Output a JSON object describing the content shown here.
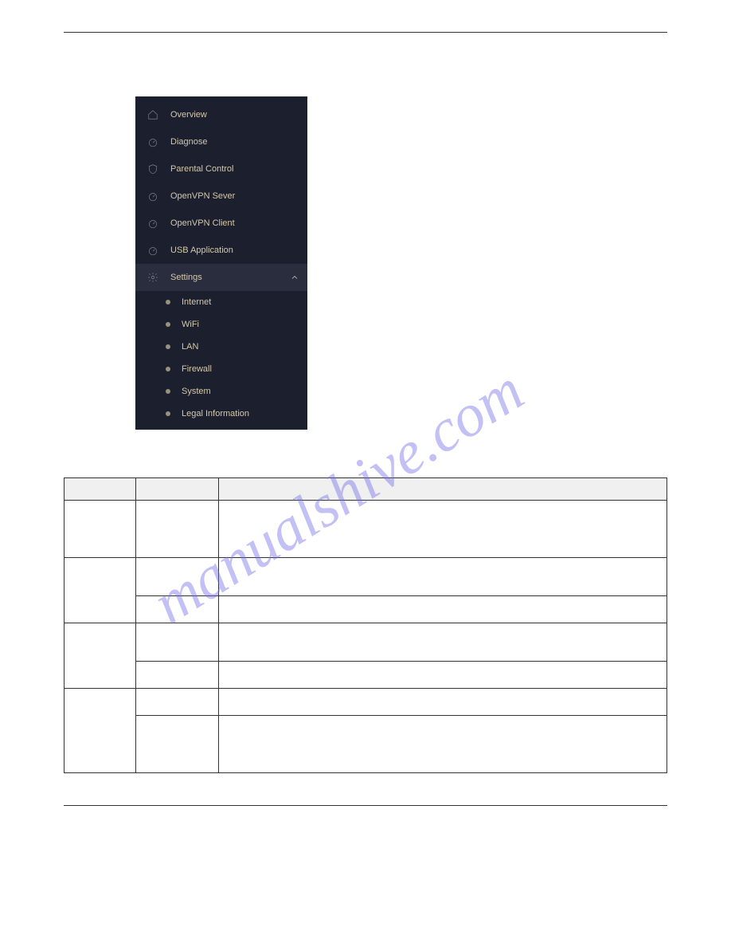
{
  "sidebar": {
    "items": [
      {
        "label": "Overview",
        "icon": "home-icon"
      },
      {
        "label": "Diagnose",
        "icon": "gauge-icon"
      },
      {
        "label": "Parental Control",
        "icon": "shield-icon"
      },
      {
        "label": "OpenVPN Sever",
        "icon": "gauge-icon"
      },
      {
        "label": "OpenVPN Client",
        "icon": "gauge-icon"
      },
      {
        "label": "USB Application",
        "icon": "gauge-icon"
      },
      {
        "label": "Settings",
        "icon": "gear-icon",
        "expanded": true
      }
    ],
    "sub_items": [
      {
        "label": "Internet"
      },
      {
        "label": "WiFi"
      },
      {
        "label": "LAN"
      },
      {
        "label": "Firewall"
      },
      {
        "label": "System"
      },
      {
        "label": "Legal Information"
      }
    ]
  },
  "watermark": "manualshive.com",
  "table": {
    "headers": [
      "",
      "",
      ""
    ]
  }
}
